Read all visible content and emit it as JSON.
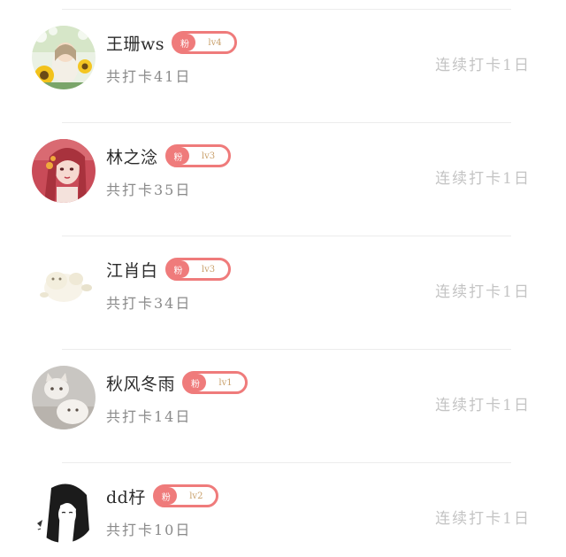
{
  "checkin_list": {
    "items": [
      {
        "name": "王珊ws",
        "badge_tag": "粉",
        "badge_level": "lv4",
        "total_days": "共打卡41日",
        "streak": "连续打卡1日",
        "avatar_icon": "girl-with-sunflowers-avatar"
      },
      {
        "name": "林之淰",
        "badge_tag": "粉",
        "badge_level": "lv3",
        "total_days": "共打卡35日",
        "streak": "连续打卡1日",
        "avatar_icon": "anime-girl-red-hair-avatar"
      },
      {
        "name": "江肖白",
        "badge_tag": "粉",
        "badge_level": "lv3",
        "total_days": "共打卡34日",
        "streak": "连续打卡1日",
        "avatar_icon": "white-fluffy-creature-avatar"
      },
      {
        "name": "秋风冬雨",
        "badge_tag": "粉",
        "badge_level": "lv1",
        "total_days": "共打卡14日",
        "streak": "连续打卡1日",
        "avatar_icon": "white-cats-avatar"
      },
      {
        "name": "dd杍",
        "badge_tag": "粉",
        "badge_level": "lv2",
        "total_days": "共打卡10日",
        "streak": "连续打卡1日",
        "avatar_icon": "sketch-girl-black-hair-avatar"
      }
    ]
  },
  "colors": {
    "badge_accent": "#ef7b7b",
    "level_text": "#c9a06b",
    "name_text": "#2b2b2b",
    "total_text": "#8a8a8a",
    "streak_text": "#c4c4c4",
    "divider": "#ececec"
  }
}
